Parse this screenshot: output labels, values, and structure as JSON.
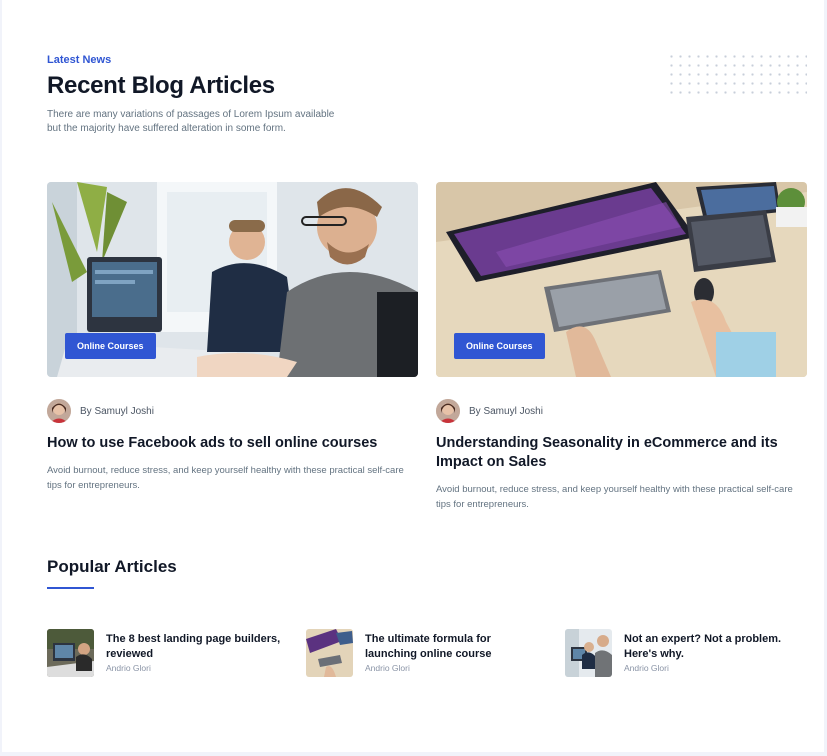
{
  "header": {
    "eyebrow": "Latest News",
    "title": "Recent Blog Articles",
    "description": "There are many variations of passages of Lorem Ipsum available but the majority have suffered alteration in some form."
  },
  "cards": [
    {
      "tag": "Online Courses",
      "author": "By Samuyl Joshi",
      "title": "How to use Facebook ads to sell online courses",
      "text": "Avoid burnout, reduce stress, and keep yourself healthy with these practical self-care tips for entrepreneurs."
    },
    {
      "tag": "Online Courses",
      "author": "By Samuyl Joshi",
      "title": "Understanding Seasonality in eCommerce and its Impact on Sales",
      "text": "Avoid burnout, reduce stress, and keep yourself healthy with these practical self-care tips for entrepreneurs."
    }
  ],
  "popular": {
    "title": "Popular Articles",
    "items": [
      {
        "title": "The 8 best landing page builders, reviewed",
        "author": "Andrio Glori"
      },
      {
        "title": "The ultimate formula for launching online course",
        "author": "Andrio Glori"
      },
      {
        "title": "Not an expert? Not a problem. Here's why.",
        "author": "Andrio Glori"
      }
    ]
  },
  "colors": {
    "accent": "#3056d3",
    "heading": "#111827",
    "body": "#637381"
  }
}
